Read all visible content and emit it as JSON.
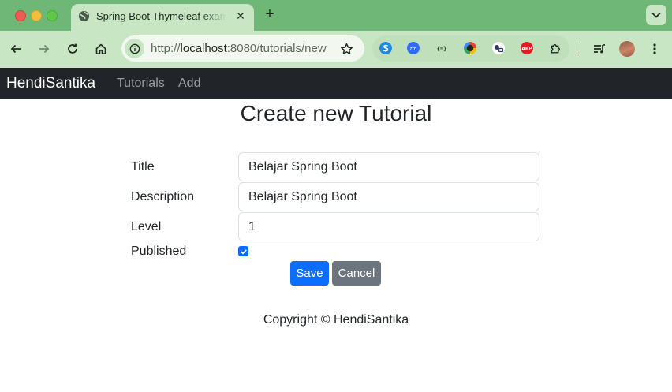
{
  "browser": {
    "tab": {
      "title": "Spring Boot Thymeleaf example",
      "favicon": "globe-icon",
      "close_glyph": "✕"
    },
    "new_tab_glyph": "+",
    "address": {
      "scheme": "http://",
      "host": "localhost",
      "path": ":8080/tutorials/new"
    },
    "extensions": [
      "s-icon",
      "zoom-icon",
      "json-formatter-icon",
      "chrome-color-icon",
      "camera-icon",
      "adblock-icon",
      "puzzle-icon"
    ],
    "theme_colors": {
      "frame": "#6fb777",
      "toolbar": "#c8e6c3"
    }
  },
  "navbar": {
    "brand": "HendiSantika",
    "links": [
      "Tutorials",
      "Add"
    ]
  },
  "page": {
    "title": "Create new Tutorial"
  },
  "form": {
    "title_label": "Title",
    "title_value": "Belajar Spring Boot",
    "description_label": "Description",
    "description_value": "Belajar Spring Boot",
    "level_label": "Level",
    "level_value": "1",
    "published_label": "Published",
    "published": true,
    "save_label": "Save",
    "cancel_label": "Cancel"
  },
  "footer": {
    "text": "Copyright © HendiSantika"
  },
  "colors": {
    "primary": "#0d6efd",
    "secondary": "#6c757d",
    "navbar": "#212529"
  }
}
